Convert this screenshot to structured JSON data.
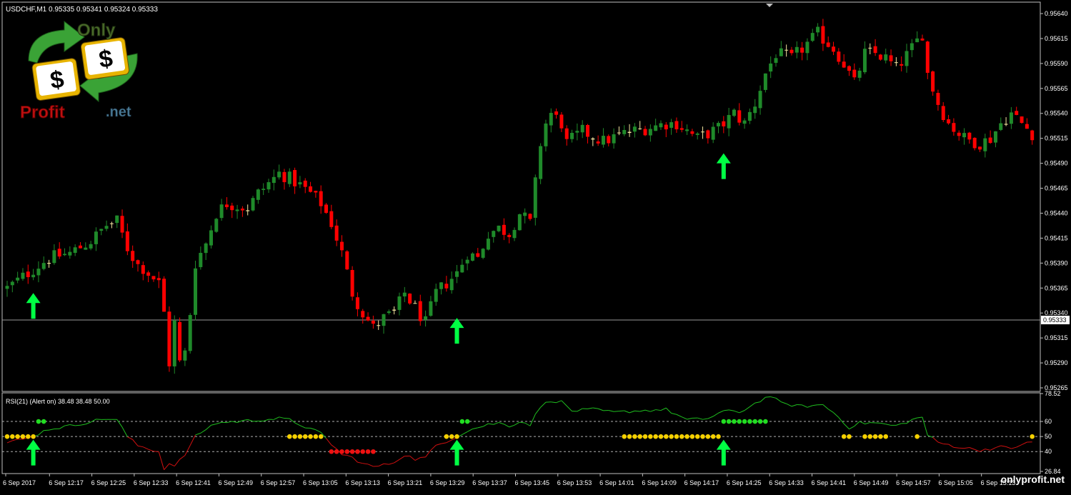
{
  "main_chart": {
    "symbol_header": "USDCHF,M1  0.95335 0.95341 0.95324 0.95333",
    "current_price_label": "0.95333",
    "current_price": 0.95333
  },
  "rsi_panel": {
    "header": "RSI(21) (Alert on) 38.48 38.48 50.00",
    "levels": [
      60,
      50,
      40
    ],
    "y_tick_labels": [
      "78.52",
      "60",
      "50",
      "40",
      "26.84"
    ],
    "ylim": [
      26.84,
      78.52
    ]
  },
  "watermark": {
    "logo_top_text": "Only",
    "logo_bottom_left_text": "Profit",
    "logo_bottom_right_text": ".net",
    "corner_text": "onlyprofit.net"
  },
  "colors": {
    "background": "#000000",
    "bull_candle": "#1f8a2a",
    "bear_candle": "#ff0000",
    "doji_candle": "#f5e6a0",
    "grid_line": "#bfbfbf",
    "rsi_up": "#1fbf1f",
    "rsi_down": "#d01010",
    "dot_yellow": "#f5d000",
    "dot_green": "#22dd22",
    "dot_red": "#ee1111",
    "arrow_green": "#00ff44"
  },
  "chart_data": [
    {
      "type": "candlestick",
      "title": "USDCHF,M1",
      "ylim": [
        0.95265,
        0.9564
      ],
      "y_ticks": [
        0.9564,
        0.95615,
        0.9559,
        0.95565,
        0.9554,
        0.95515,
        0.9549,
        0.95465,
        0.9544,
        0.95415,
        0.9539,
        0.95365,
        0.9534,
        0.95315,
        0.9529,
        0.95265
      ],
      "y_tick_labels": [
        "0.95640",
        "0.95615",
        "0.95590",
        "0.95565",
        "0.95540",
        "0.95515",
        "0.95490",
        "0.95465",
        "0.95440",
        "0.95415",
        "0.95390",
        "0.95365",
        "0.95340",
        "0.95315",
        "0.95290",
        "0.95265"
      ],
      "x_tick_labels": [
        "6 Sep 2017",
        "6 Sep 12:17",
        "6 Sep 12:25",
        "6 Sep 12:33",
        "6 Sep 12:41",
        "6 Sep 12:49",
        "6 Sep 12:57",
        "6 Sep 13:05",
        "6 Sep 13:13",
        "6 Sep 13:21",
        "6 Sep 13:29",
        "6 Sep 13:37",
        "6 Sep 13:45",
        "6 Sep 13:53",
        "6 Sep 14:01",
        "6 Sep 14:09",
        "6 Sep 14:17",
        "6 Sep 14:25",
        "6 Sep 14:33",
        "6 Sep 14:41",
        "6 Sep 14:49",
        "6 Sep 14:57",
        "6 Sep 15:05",
        "6 Sep 15:13"
      ],
      "close_path": [
        {
          "x": 0,
          "y": 0.95365
        },
        {
          "x": 4,
          "y": 0.9538
        },
        {
          "x": 8,
          "y": 0.95395
        },
        {
          "x": 12,
          "y": 0.954
        },
        {
          "x": 16,
          "y": 0.95412
        },
        {
          "x": 19,
          "y": 0.95428
        },
        {
          "x": 21,
          "y": 0.95432
        },
        {
          "x": 23,
          "y": 0.95405
        },
        {
          "x": 25,
          "y": 0.95388
        },
        {
          "x": 26,
          "y": 0.95385
        },
        {
          "x": 28,
          "y": 0.95375
        },
        {
          "x": 29,
          "y": 0.9537
        },
        {
          "x": 30,
          "y": 0.9534
        },
        {
          "x": 31,
          "y": 0.9529
        },
        {
          "x": 32,
          "y": 0.9533
        },
        {
          "x": 33,
          "y": 0.9529
        },
        {
          "x": 34,
          "y": 0.953
        },
        {
          "x": 35,
          "y": 0.9534
        },
        {
          "x": 36,
          "y": 0.9539
        },
        {
          "x": 38,
          "y": 0.9541
        },
        {
          "x": 40,
          "y": 0.9544
        },
        {
          "x": 42,
          "y": 0.9545
        },
        {
          "x": 46,
          "y": 0.95445
        },
        {
          "x": 48,
          "y": 0.9546
        },
        {
          "x": 50,
          "y": 0.9547
        },
        {
          "x": 52,
          "y": 0.9548
        },
        {
          "x": 54,
          "y": 0.95475
        },
        {
          "x": 56,
          "y": 0.95468
        },
        {
          "x": 58,
          "y": 0.9546
        },
        {
          "x": 60,
          "y": 0.9545
        },
        {
          "x": 62,
          "y": 0.9543
        },
        {
          "x": 64,
          "y": 0.954
        },
        {
          "x": 66,
          "y": 0.9536
        },
        {
          "x": 68,
          "y": 0.9534
        },
        {
          "x": 70,
          "y": 0.95325
        },
        {
          "x": 72,
          "y": 0.95335
        },
        {
          "x": 74,
          "y": 0.9534
        },
        {
          "x": 76,
          "y": 0.9536
        },
        {
          "x": 78,
          "y": 0.95345
        },
        {
          "x": 80,
          "y": 0.9533
        },
        {
          "x": 82,
          "y": 0.9536
        },
        {
          "x": 84,
          "y": 0.9537
        },
        {
          "x": 86,
          "y": 0.9538
        },
        {
          "x": 88,
          "y": 0.954
        },
        {
          "x": 90,
          "y": 0.95395
        },
        {
          "x": 92,
          "y": 0.9542
        },
        {
          "x": 94,
          "y": 0.95425
        },
        {
          "x": 96,
          "y": 0.9542
        },
        {
          "x": 98,
          "y": 0.9544
        },
        {
          "x": 100,
          "y": 0.9543
        },
        {
          "x": 101,
          "y": 0.9547
        },
        {
          "x": 102,
          "y": 0.9551
        },
        {
          "x": 103,
          "y": 0.9553
        },
        {
          "x": 104,
          "y": 0.9554
        },
        {
          "x": 106,
          "y": 0.9553
        },
        {
          "x": 107,
          "y": 0.9551
        },
        {
          "x": 110,
          "y": 0.95522
        },
        {
          "x": 114,
          "y": 0.95512
        },
        {
          "x": 118,
          "y": 0.9552
        },
        {
          "x": 122,
          "y": 0.95525
        },
        {
          "x": 126,
          "y": 0.9553
        },
        {
          "x": 128,
          "y": 0.9553
        },
        {
          "x": 132,
          "y": 0.95515
        },
        {
          "x": 136,
          "y": 0.95525
        },
        {
          "x": 139,
          "y": 0.9554
        },
        {
          "x": 141,
          "y": 0.9553
        },
        {
          "x": 143,
          "y": 0.9555
        },
        {
          "x": 145,
          "y": 0.9558
        },
        {
          "x": 147,
          "y": 0.956
        },
        {
          "x": 150,
          "y": 0.95595
        },
        {
          "x": 153,
          "y": 0.9561
        },
        {
          "x": 155,
          "y": 0.9562
        },
        {
          "x": 158,
          "y": 0.95605
        },
        {
          "x": 160,
          "y": 0.9559
        },
        {
          "x": 162,
          "y": 0.9557
        },
        {
          "x": 164,
          "y": 0.956
        },
        {
          "x": 166,
          "y": 0.956
        },
        {
          "x": 168,
          "y": 0.95595
        },
        {
          "x": 170,
          "y": 0.95585
        },
        {
          "x": 173,
          "y": 0.95605
        },
        {
          "x": 175,
          "y": 0.9562
        },
        {
          "x": 176,
          "y": 0.9558
        },
        {
          "x": 178,
          "y": 0.9555
        },
        {
          "x": 180,
          "y": 0.9553
        },
        {
          "x": 183,
          "y": 0.95515
        },
        {
          "x": 186,
          "y": 0.9551
        },
        {
          "x": 188,
          "y": 0.95515
        },
        {
          "x": 190,
          "y": 0.9553
        },
        {
          "x": 192,
          "y": 0.9554
        },
        {
          "x": 194,
          "y": 0.9553
        },
        {
          "x": 196,
          "y": 0.9552
        }
      ],
      "annotations": [
        {
          "type": "up-arrow",
          "x": 5,
          "y": 0.9536
        },
        {
          "type": "up-arrow",
          "x": 86,
          "y": 0.95335
        },
        {
          "type": "up-arrow",
          "x": 137,
          "y": 0.955
        }
      ]
    },
    {
      "type": "line",
      "title": "RSI(21) (Alert on) 38.48 38.48 50.00",
      "ylim": [
        26.84,
        78.52
      ],
      "levels": [
        60,
        50,
        40
      ],
      "rsi_line": [
        {
          "x": 0,
          "y": 46
        },
        {
          "x": 4,
          "y": 49
        },
        {
          "x": 6,
          "y": 52
        },
        {
          "x": 8,
          "y": 55
        },
        {
          "x": 12,
          "y": 57
        },
        {
          "x": 16,
          "y": 60
        },
        {
          "x": 19,
          "y": 62
        },
        {
          "x": 21,
          "y": 61
        },
        {
          "x": 23,
          "y": 50
        },
        {
          "x": 25,
          "y": 44
        },
        {
          "x": 27,
          "y": 42
        },
        {
          "x": 29,
          "y": 40
        },
        {
          "x": 30,
          "y": 28
        },
        {
          "x": 31,
          "y": 33
        },
        {
          "x": 32,
          "y": 30
        },
        {
          "x": 34,
          "y": 38
        },
        {
          "x": 36,
          "y": 50
        },
        {
          "x": 38,
          "y": 55
        },
        {
          "x": 40,
          "y": 59
        },
        {
          "x": 44,
          "y": 60
        },
        {
          "x": 48,
          "y": 61
        },
        {
          "x": 52,
          "y": 62
        },
        {
          "x": 54,
          "y": 61
        },
        {
          "x": 56,
          "y": 58
        },
        {
          "x": 58,
          "y": 55
        },
        {
          "x": 60,
          "y": 52
        },
        {
          "x": 62,
          "y": 45
        },
        {
          "x": 64,
          "y": 38
        },
        {
          "x": 66,
          "y": 36
        },
        {
          "x": 68,
          "y": 32
        },
        {
          "x": 70,
          "y": 30
        },
        {
          "x": 72,
          "y": 31
        },
        {
          "x": 74,
          "y": 33
        },
        {
          "x": 76,
          "y": 38
        },
        {
          "x": 78,
          "y": 35
        },
        {
          "x": 80,
          "y": 36
        },
        {
          "x": 82,
          "y": 44
        },
        {
          "x": 84,
          "y": 47
        },
        {
          "x": 86,
          "y": 50
        },
        {
          "x": 88,
          "y": 54
        },
        {
          "x": 90,
          "y": 56
        },
        {
          "x": 92,
          "y": 58
        },
        {
          "x": 94,
          "y": 59
        },
        {
          "x": 96,
          "y": 57
        },
        {
          "x": 98,
          "y": 60
        },
        {
          "x": 100,
          "y": 58
        },
        {
          "x": 102,
          "y": 70
        },
        {
          "x": 104,
          "y": 74
        },
        {
          "x": 106,
          "y": 73
        },
        {
          "x": 108,
          "y": 67
        },
        {
          "x": 112,
          "y": 68
        },
        {
          "x": 116,
          "y": 66
        },
        {
          "x": 120,
          "y": 67
        },
        {
          "x": 126,
          "y": 68
        },
        {
          "x": 130,
          "y": 61
        },
        {
          "x": 134,
          "y": 62
        },
        {
          "x": 137,
          "y": 67
        },
        {
          "x": 140,
          "y": 66
        },
        {
          "x": 144,
          "y": 74
        },
        {
          "x": 146,
          "y": 77
        },
        {
          "x": 148,
          "y": 72
        },
        {
          "x": 152,
          "y": 70
        },
        {
          "x": 156,
          "y": 71
        },
        {
          "x": 158,
          "y": 66
        },
        {
          "x": 161,
          "y": 56
        },
        {
          "x": 163,
          "y": 59
        },
        {
          "x": 166,
          "y": 59
        },
        {
          "x": 170,
          "y": 57
        },
        {
          "x": 173,
          "y": 61
        },
        {
          "x": 175,
          "y": 63
        },
        {
          "x": 176,
          "y": 51
        },
        {
          "x": 178,
          "y": 46
        },
        {
          "x": 182,
          "y": 43
        },
        {
          "x": 186,
          "y": 41
        },
        {
          "x": 190,
          "y": 43
        },
        {
          "x": 192,
          "y": 42
        },
        {
          "x": 194,
          "y": 45
        },
        {
          "x": 196,
          "y": 46
        }
      ],
      "dot_markers": [
        {
          "color": "yellow",
          "x_from": 0,
          "x_to": 5,
          "y": 50
        },
        {
          "color": "green",
          "x_from": 6,
          "x_to": 7,
          "y": 60
        },
        {
          "color": "yellow",
          "x_from": 54,
          "x_to": 60,
          "y": 50
        },
        {
          "color": "red",
          "x_from": 62,
          "x_to": 70,
          "y": 40
        },
        {
          "color": "yellow",
          "x_from": 84,
          "x_to": 86,
          "y": 50
        },
        {
          "color": "green",
          "x_from": 87,
          "x_to": 88,
          "y": 60
        },
        {
          "color": "yellow",
          "x_from": 118,
          "x_to": 136,
          "y": 50
        },
        {
          "color": "green",
          "x_from": 137,
          "x_to": 145,
          "y": 60
        },
        {
          "color": "yellow",
          "x_from": 160,
          "x_to": 161,
          "y": 50
        },
        {
          "color": "yellow",
          "x_from": 164,
          "x_to": 168,
          "y": 50
        },
        {
          "color": "yellow",
          "x_from": 174,
          "x_to": 174,
          "y": 50
        },
        {
          "color": "yellow",
          "x_from": 196,
          "x_to": 196,
          "y": 50
        }
      ],
      "annotations": [
        {
          "type": "up-arrow",
          "x": 5,
          "y": 46
        },
        {
          "type": "up-arrow",
          "x": 86,
          "y": 46
        },
        {
          "type": "up-arrow",
          "x": 137,
          "y": 46
        }
      ]
    }
  ]
}
